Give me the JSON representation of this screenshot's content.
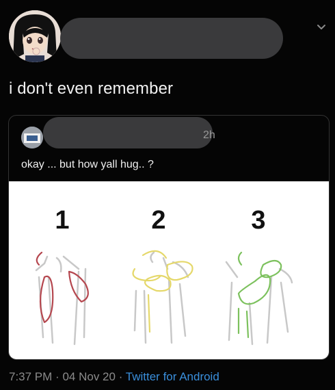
{
  "tweet": {
    "text": "i don't even remember",
    "timestamp_time": "7:37 PM",
    "separator": "·",
    "timestamp_date": "04 Nov 20",
    "source": "Twitter for Android"
  },
  "quoted_tweet": {
    "time": "2h",
    "text": "okay ... but how yall hug.. ?",
    "figure_labels": [
      "1",
      "2",
      "3"
    ]
  },
  "icons": {
    "menu": "chevron-down-icon",
    "avatar": "anime-avatar",
    "quoted_avatar": "user-avatar"
  },
  "colors": {
    "background": "#050505",
    "link": "#3a8fdc",
    "hug1": "#b5474f",
    "hug2": "#e5d86a",
    "hug3": "#7cc15d"
  }
}
